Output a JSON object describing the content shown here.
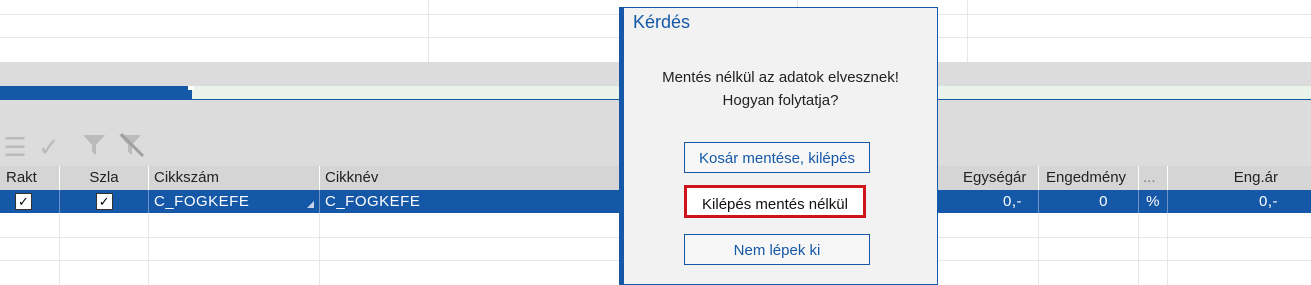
{
  "table": {
    "headers": [
      "Rakt",
      "Szla",
      "Cikkszám",
      "Cikknév",
      "Egységár",
      "Engedmény",
      "...",
      "Eng.ár"
    ],
    "selected_row": {
      "rakt_checked": "✓",
      "szla_checked": "✓",
      "cikkszam": "C_FOGKEFE",
      "cikknev": "C_FOGKEFE",
      "egysegar": "0,-",
      "engedmeny": "0",
      "unit": "%",
      "eng_ar": "0,-"
    }
  },
  "toolbar": {
    "icons": [
      "list-icon",
      "check-icon",
      "filter-icon",
      "filter-clear-icon"
    ]
  },
  "dialog": {
    "title": "Kérdés",
    "message_line1": "Mentés nélkül az adatok elvesznek!",
    "message_line2": "Hogyan folytatja?",
    "buttons": {
      "save_exit": "Kosár mentése, kilépés",
      "exit_no_save": "Kilépés mentés nélkül",
      "stay": "Nem lépek ki"
    }
  },
  "colors": {
    "accent": "#1558a8",
    "highlight_border": "#d0141c",
    "band_gray": "#dcdcdc"
  }
}
